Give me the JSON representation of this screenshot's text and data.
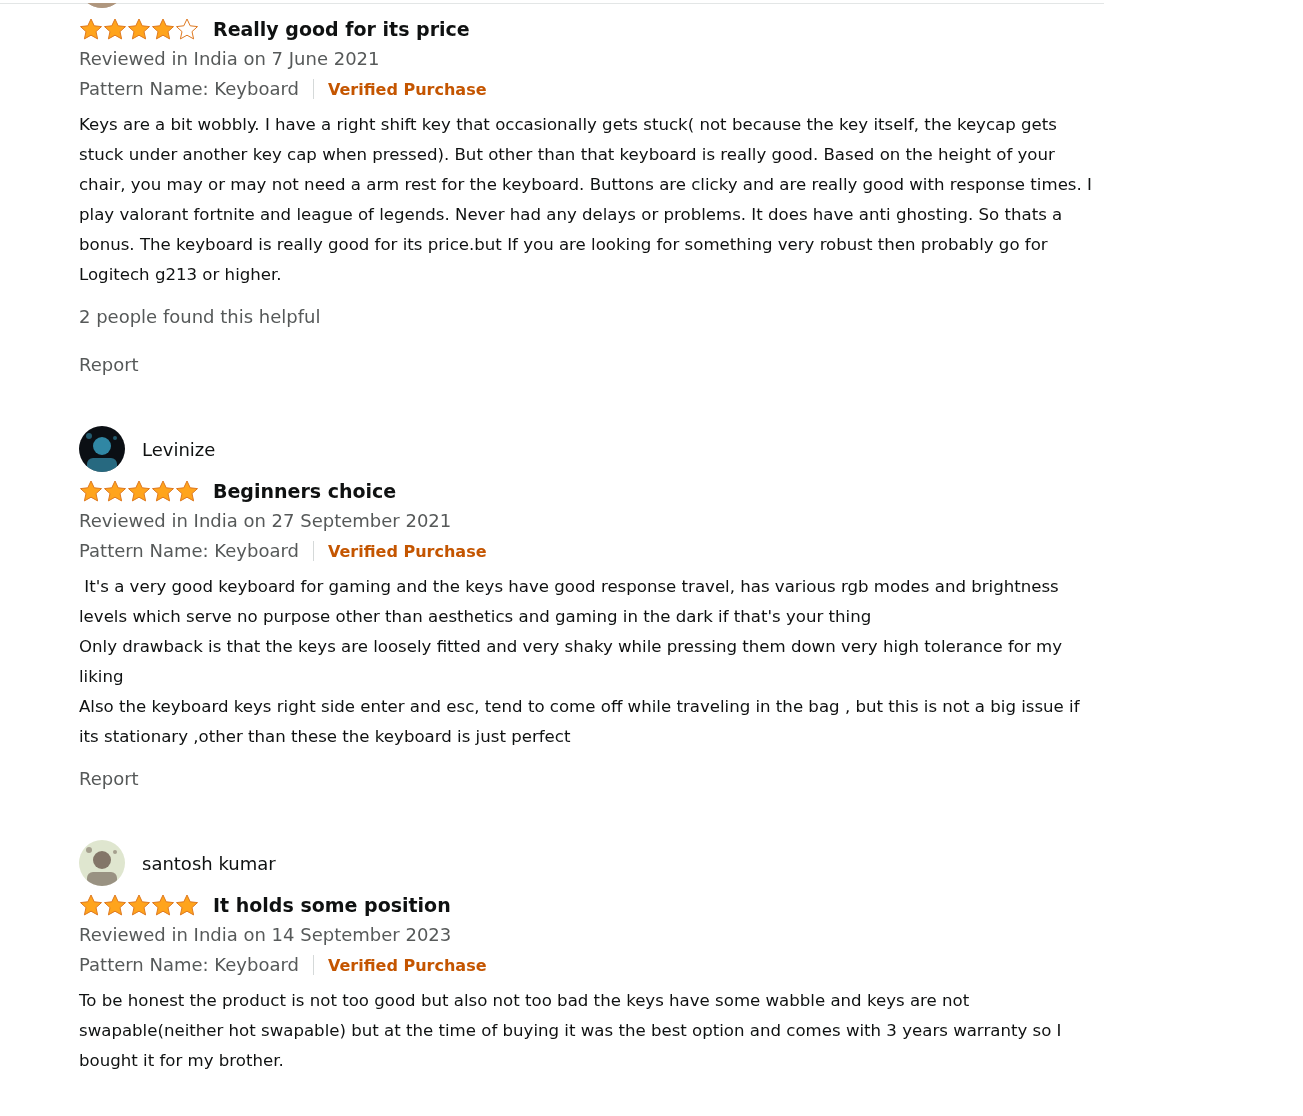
{
  "reviews": [
    {
      "stars": 4,
      "title": "Really good for its price",
      "date": "Reviewed in India on 7 June 2021",
      "pattern": "Pattern Name: Keyboard",
      "verified": "Verified Purchase",
      "body": "Keys are a bit wobbly. I have a right shift key that occasionally gets stuck( not because the key itself, the keycap gets stuck under another key cap when pressed). But other than that keyboard is really good. Based on the height of your chair, you may or may not need a arm rest for the keyboard. Buttons are clicky and are really good with response times. I play valorant fortnite and league of legends. Never had any delays or problems. It does have anti ghosting. So thats a bonus. The keyboard is really good for its price.but If you are looking for something very robust then probably go for Logitech g213 or higher.",
      "helpful": "2 people found this helpful",
      "report": "Report"
    },
    {
      "author": "Levinize",
      "stars": 5,
      "title": "Beginners choice",
      "date": "Reviewed in India on 27 September 2021",
      "pattern": "Pattern Name: Keyboard",
      "verified": "Verified Purchase",
      "body": " It's a very good keyboard for gaming and the keys have good response travel, has various rgb modes and brightness levels which serve no purpose other than aesthetics and gaming in the dark if that's your thing\nOnly drawback is that the keys are loosely fitted and very shaky while pressing them down very high tolerance for my liking\nAlso the keyboard keys right side enter and esc, tend to come off while traveling in the bag , but this is not a big issue if its stationary ,other than these the keyboard is just perfect",
      "report": "Report"
    },
    {
      "author": "santosh kumar",
      "stars": 5,
      "title": "It holds some position",
      "date": "Reviewed in India on 14 September 2023",
      "pattern": "Pattern Name: Keyboard",
      "verified": "Verified Purchase",
      "body": "To be honest the product is not too good but also not too bad the keys have some wabble and keys are not swapable(neither hot swapable) but at the time of buying it was the best option and comes with 3 years warranty so I bought it for my brother."
    }
  ]
}
